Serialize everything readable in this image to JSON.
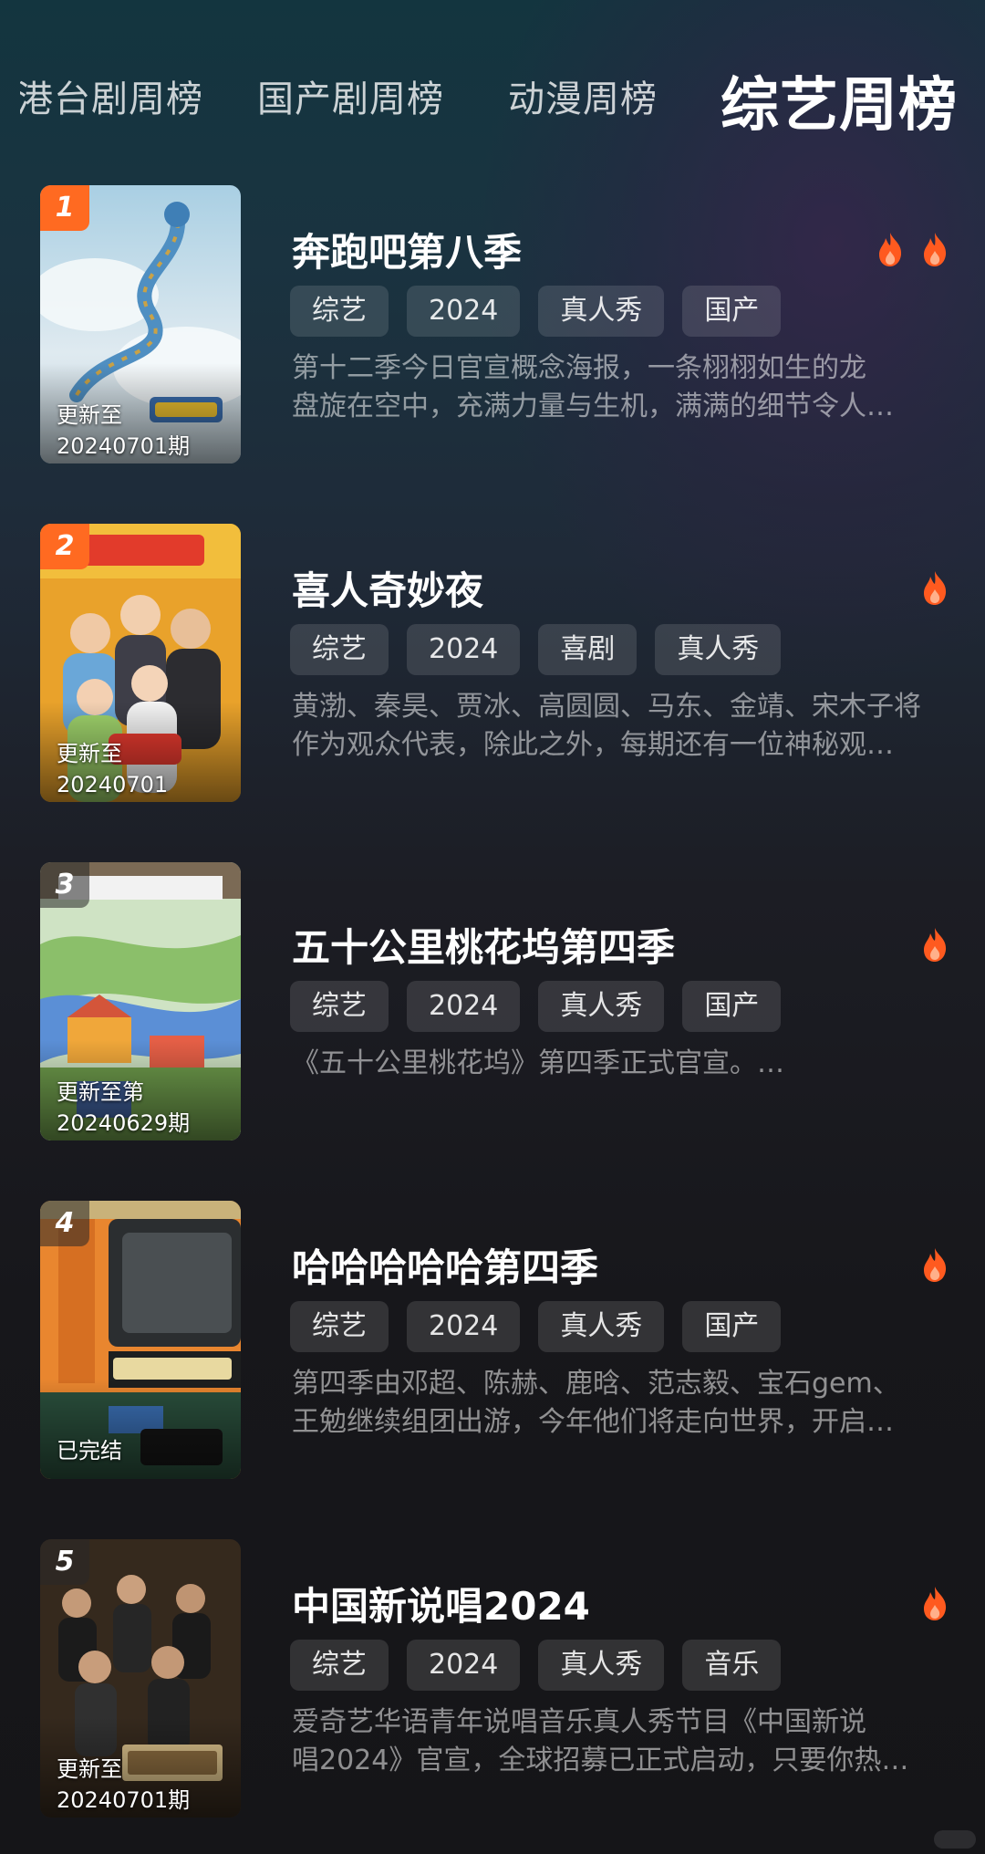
{
  "tabs": [
    {
      "label": "港台剧周榜",
      "active": false
    },
    {
      "label": "国产剧周榜",
      "active": false
    },
    {
      "label": "动漫周榜",
      "active": false
    },
    {
      "label": "综艺周榜",
      "active": true
    }
  ],
  "items": [
    {
      "rank": "1",
      "title": "奔跑吧第八季",
      "heat_icons": 2,
      "tags": [
        "综艺",
        "2024",
        "真人秀",
        "国产"
      ],
      "desc_lines": [
        "第十二季今日官宣概念海报，一条栩栩如生的龙",
        "盘旋在空中，充满力量与生机，满满的细节令人…"
      ],
      "update_lines": [
        "更新至",
        "20240701期"
      ],
      "poster_theme": "dragon-sky"
    },
    {
      "rank": "2",
      "title": "喜人奇妙夜",
      "heat_icons": 1,
      "tags": [
        "综艺",
        "2024",
        "喜剧",
        "真人秀"
      ],
      "desc_lines": [
        "黄渤、秦昊、贾冰、高圆圆、马东、金靖、宋木子将",
        "作为观众代表，除此之外，每期还有一位神秘观…"
      ],
      "update_lines": [
        "更新至",
        "20240701"
      ],
      "poster_theme": "comedy-group"
    },
    {
      "rank": "3",
      "title": "五十公里桃花坞第四季",
      "heat_icons": 1,
      "tags": [
        "综艺",
        "2024",
        "真人秀",
        "国产"
      ],
      "desc_lines": [
        "《五十公里桃花坞》第四季正式官宣。…"
      ],
      "update_lines": [
        "更新至第",
        "20240629期"
      ],
      "poster_theme": "village-illustration"
    },
    {
      "rank": "4",
      "title": "哈哈哈哈哈第四季",
      "heat_icons": 1,
      "tags": [
        "综艺",
        "2024",
        "真人秀",
        "国产"
      ],
      "desc_lines": [
        "第四季由邓超、陈赫、鹿晗、范志毅、宝石gem、",
        "王勉继续组团出游，今年他们将走向世界，开启…"
      ],
      "update_lines": [
        "已完结"
      ],
      "poster_theme": "train"
    },
    {
      "rank": "5",
      "title": "中国新说唱2024",
      "heat_icons": 1,
      "tags": [
        "综艺",
        "2024",
        "真人秀",
        "音乐"
      ],
      "desc_lines": [
        "爱奇艺华语青年说唱音乐真人秀节目《中国新说",
        "唱2024》官宣，全球招募已正式启动，只要你热…"
      ],
      "update_lines": [
        "更新至",
        "20240701期"
      ],
      "poster_theme": "rap-group"
    }
  ],
  "colors": {
    "rank_badge": "#ff6a21",
    "fire": "#ff5a1f",
    "tag_bg": "#3a3a3e"
  },
  "icons": {
    "heat": "fire-icon"
  }
}
